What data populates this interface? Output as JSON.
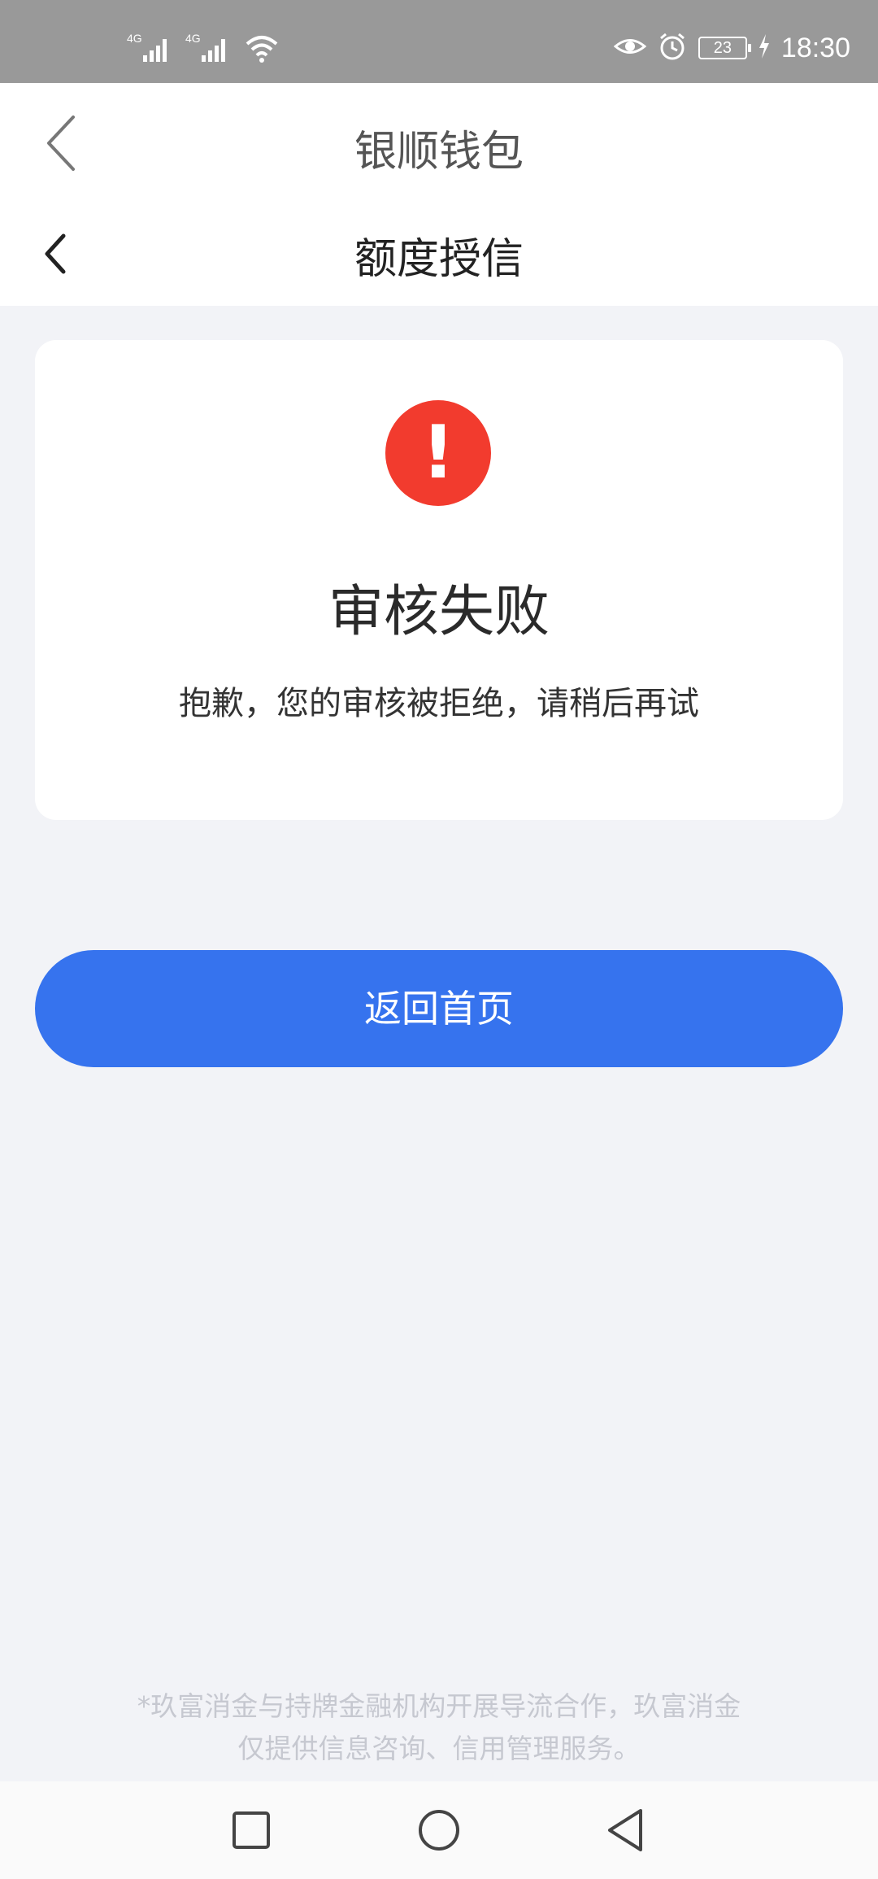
{
  "status_bar": {
    "network_1": "4G",
    "network_2": "4G",
    "battery": "23",
    "time": "18:30",
    "icons": [
      "signal-icon",
      "signal-icon",
      "wifi-icon",
      "eye-icon",
      "alarm-icon",
      "battery-icon",
      "charging-icon"
    ]
  },
  "app_header": {
    "title": "银顺钱包",
    "back_icon": "chevron-left-icon"
  },
  "page_header": {
    "title": "额度授信",
    "back_icon": "chevron-left-icon"
  },
  "result_card": {
    "icon": "exclamation-icon",
    "icon_glyph": "!",
    "icon_color": "#f23b2e",
    "title": "审核失败",
    "message": "抱歉，您的审核被拒绝，请稍后再试"
  },
  "actions": {
    "home_button": "返回首页",
    "accent_color": "#3673ee"
  },
  "disclaimer": {
    "line1": "*玖富消金与持牌金融机构开展导流合作，玖富消金",
    "line2": "仅提供信息咨询、信用管理服务。"
  },
  "system_nav": {
    "icons": [
      "recents-square-icon",
      "home-circle-icon",
      "back-triangle-icon"
    ]
  }
}
